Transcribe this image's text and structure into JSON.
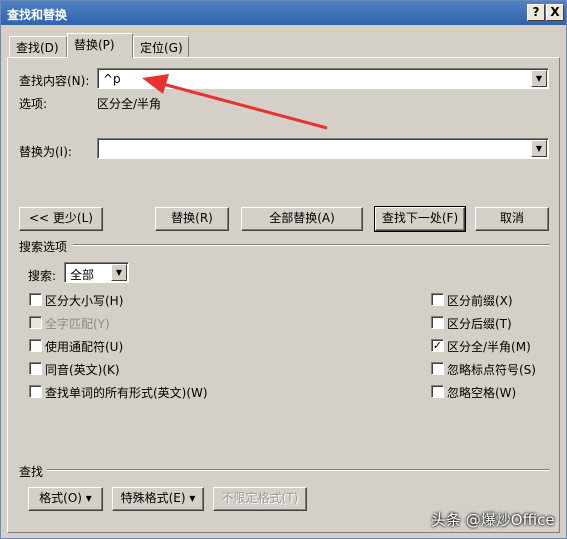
{
  "window": {
    "title": "查找和替换",
    "help": "?",
    "close": "X"
  },
  "tabs": [
    {
      "label": "查找(D)"
    },
    {
      "label": "替换(P)"
    },
    {
      "label": "定位(G)"
    }
  ],
  "find": {
    "label": "查找内容(N):",
    "value": "^p"
  },
  "options": {
    "label": "选项:",
    "value": "区分全/半角"
  },
  "replace": {
    "label": "替换为(I):",
    "value": ""
  },
  "buttons": {
    "less": "<< 更少(L)",
    "replace": "替换(R)",
    "replace_all": "全部替换(A)",
    "find_next": "查找下一处(F)",
    "cancel": "取消"
  },
  "search_options": {
    "section_label": "搜索选项",
    "search_label": "搜索:",
    "search_value": "全部"
  },
  "checkboxes_left": [
    {
      "label": "区分大小写(H)",
      "checked": false,
      "disabled": false
    },
    {
      "label": "全字匹配(Y)",
      "checked": false,
      "disabled": true
    },
    {
      "label": "使用通配符(U)",
      "checked": false,
      "disabled": false
    },
    {
      "label": "同音(英文)(K)",
      "checked": false,
      "disabled": false
    },
    {
      "label": "查找单词的所有形式(英文)(W)",
      "checked": false,
      "disabled": false
    }
  ],
  "checkboxes_right": [
    {
      "label": "区分前缀(X)",
      "checked": false
    },
    {
      "label": "区分后缀(T)",
      "checked": false
    },
    {
      "label": "区分全/半角(M)",
      "checked": true
    },
    {
      "label": "忽略标点符号(S)",
      "checked": false
    },
    {
      "label": "忽略空格(W)",
      "checked": false
    }
  ],
  "find_section": {
    "label": "查找",
    "format": "格式(O) ▾",
    "special": "特殊格式(E) ▾",
    "no_format": "不限定格式(T)"
  },
  "annotation": {
    "arrow_color": "#e8322e"
  },
  "watermark": "头条 @爆炒Office"
}
